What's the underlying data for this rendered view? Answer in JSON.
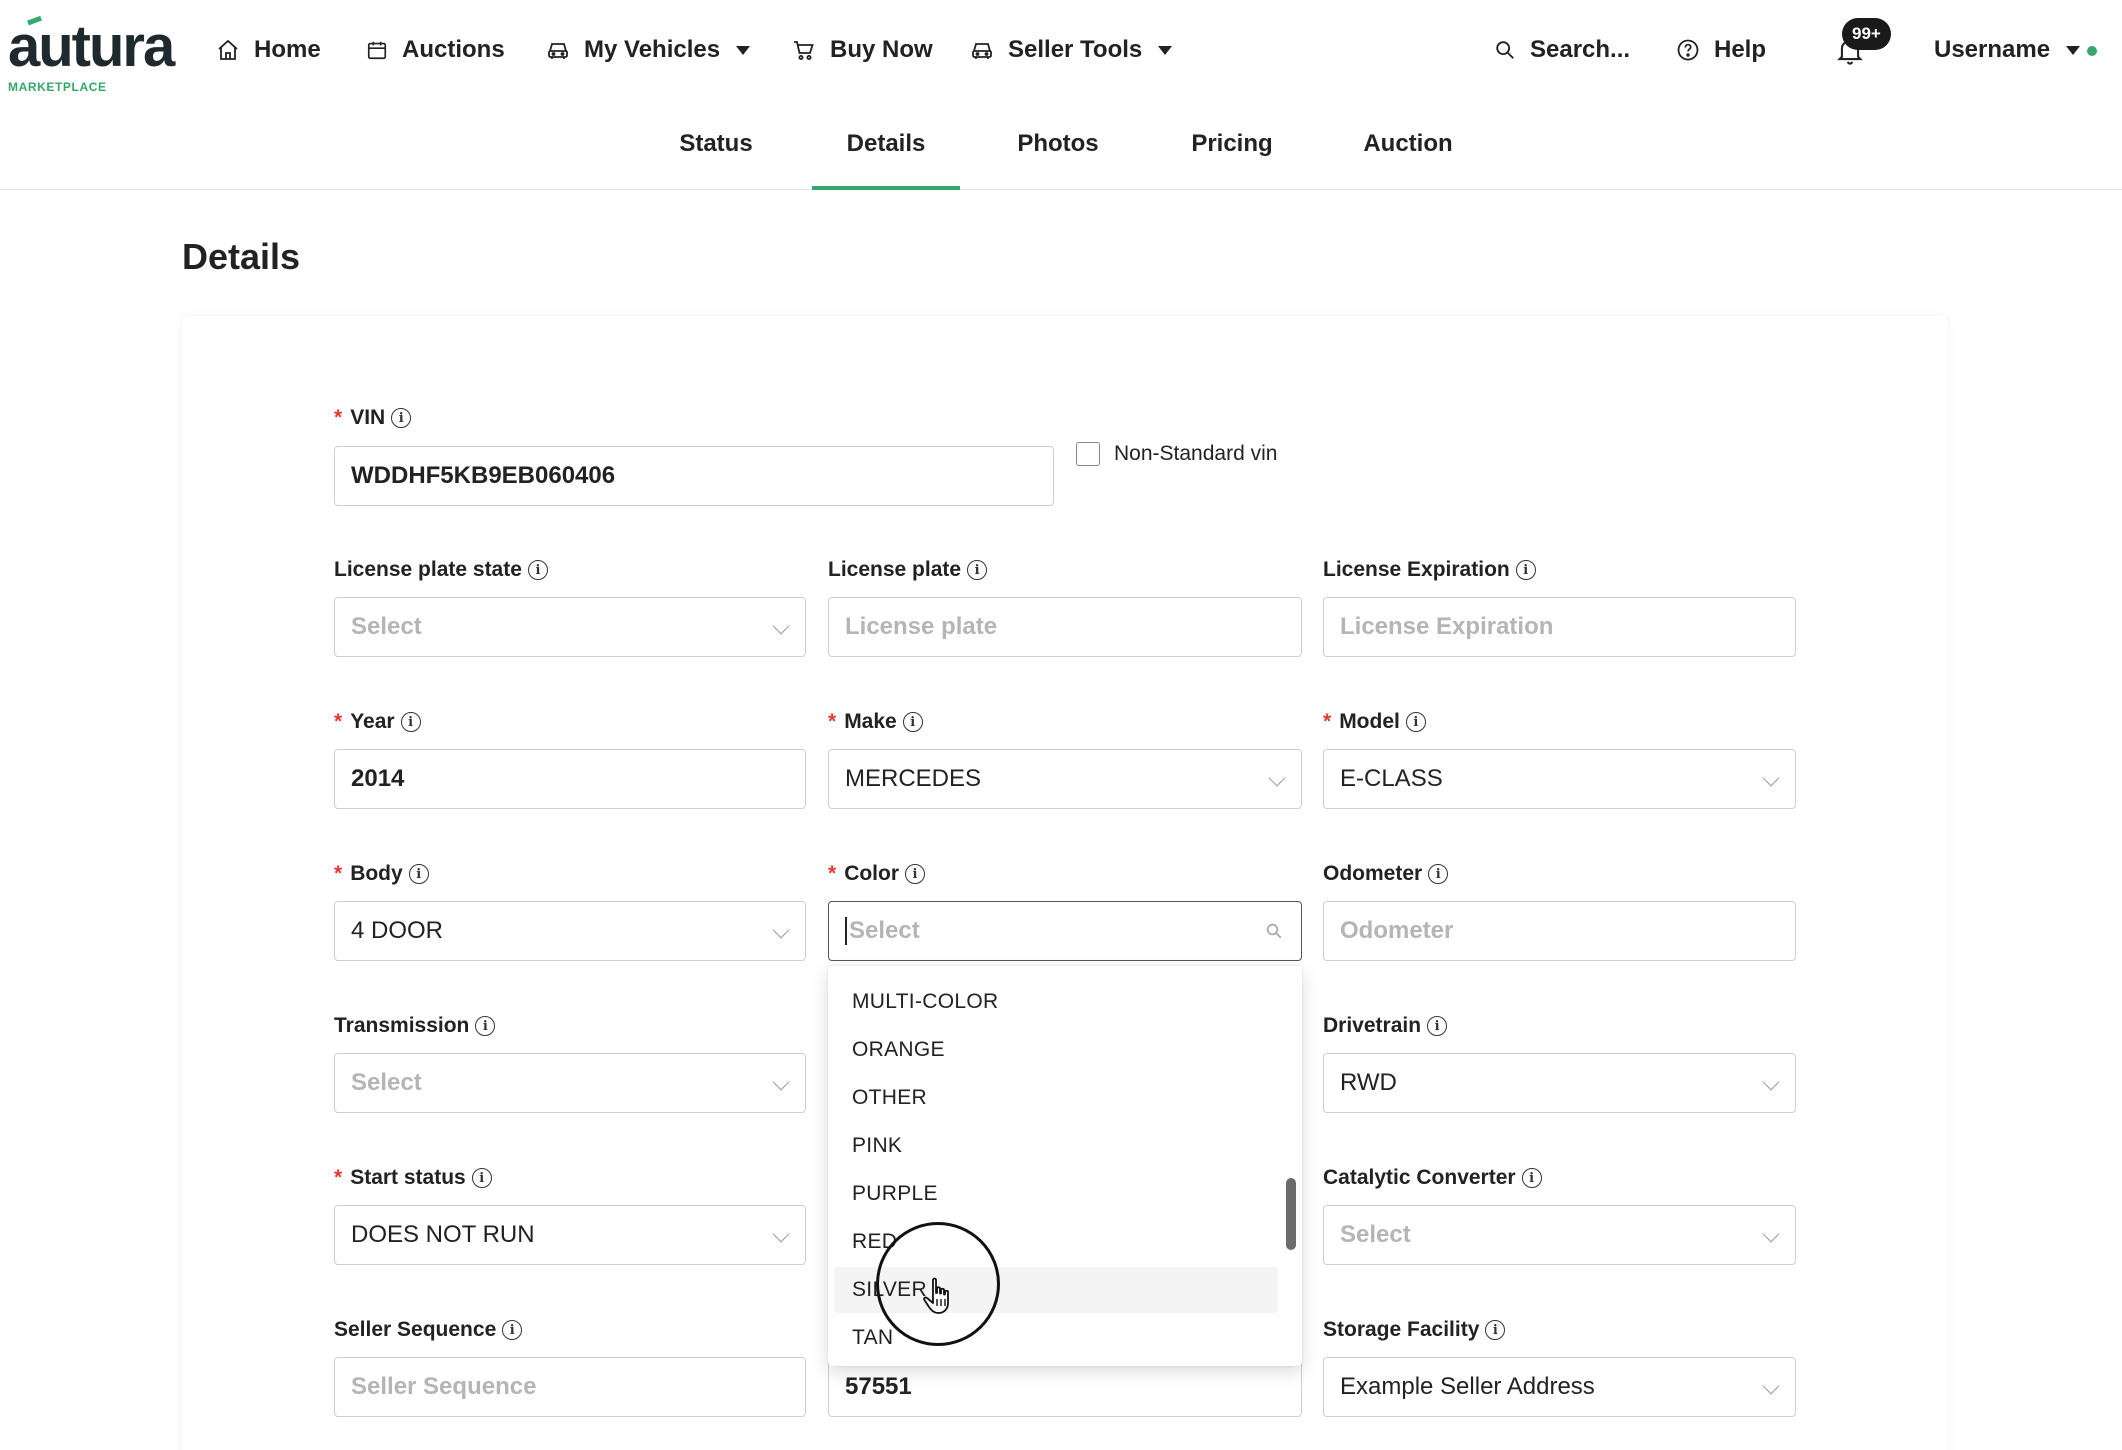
{
  "brand": {
    "logo_text": "autura",
    "logo_sub": "MARKETPLACE",
    "accent_color": "#35a86b"
  },
  "nav": {
    "home": "Home",
    "auctions": "Auctions",
    "my_vehicles": "My Vehicles",
    "buy_now": "Buy Now",
    "seller_tools": "Seller Tools",
    "search": "Search...",
    "help": "Help",
    "notifications_count": "99+",
    "username": "Username"
  },
  "tabs": [
    {
      "label": "Status"
    },
    {
      "label": "Details"
    },
    {
      "label": "Photos"
    },
    {
      "label": "Pricing"
    },
    {
      "label": "Auction"
    }
  ],
  "page_title": "Details",
  "form": {
    "vin": {
      "label": "VIN",
      "value": "WDDHF5KB9EB060406"
    },
    "non_standard_vin": {
      "label": "Non-Standard vin"
    },
    "license_plate_state": {
      "label": "License plate state",
      "placeholder": "Select"
    },
    "license_plate": {
      "label": "License plate",
      "placeholder": "License plate"
    },
    "license_expiration": {
      "label": "License Expiration",
      "placeholder": "License Expiration"
    },
    "year": {
      "label": "Year",
      "value": "2014"
    },
    "make": {
      "label": "Make",
      "value": "MERCEDES"
    },
    "model": {
      "label": "Model",
      "value": "E-CLASS"
    },
    "body": {
      "label": "Body",
      "value": "4 DOOR"
    },
    "color": {
      "label": "Color",
      "placeholder": "Select"
    },
    "odometer": {
      "label": "Odometer",
      "placeholder": "Odometer"
    },
    "transmission": {
      "label": "Transmission",
      "placeholder": "Select"
    },
    "drivetrain": {
      "label": "Drivetrain",
      "value": "RWD"
    },
    "start_status": {
      "label": "Start status",
      "value": "DOES NOT RUN"
    },
    "catalytic_converter": {
      "label": "Catalytic Converter",
      "placeholder": "Select"
    },
    "seller_sequence": {
      "label": "Seller Sequence",
      "placeholder": "Seller Sequence"
    },
    "middle_bottom": {
      "value": "57551"
    },
    "storage_facility": {
      "label": "Storage Facility",
      "value": "Example Seller Address"
    },
    "required_mark": "*",
    "info_glyph": "i"
  },
  "color_options": [
    "MULTI-COLOR",
    "ORANGE",
    "OTHER",
    "PINK",
    "PURPLE",
    "RED",
    "SILVER",
    "TAN"
  ],
  "hovered_option": "SILVER"
}
